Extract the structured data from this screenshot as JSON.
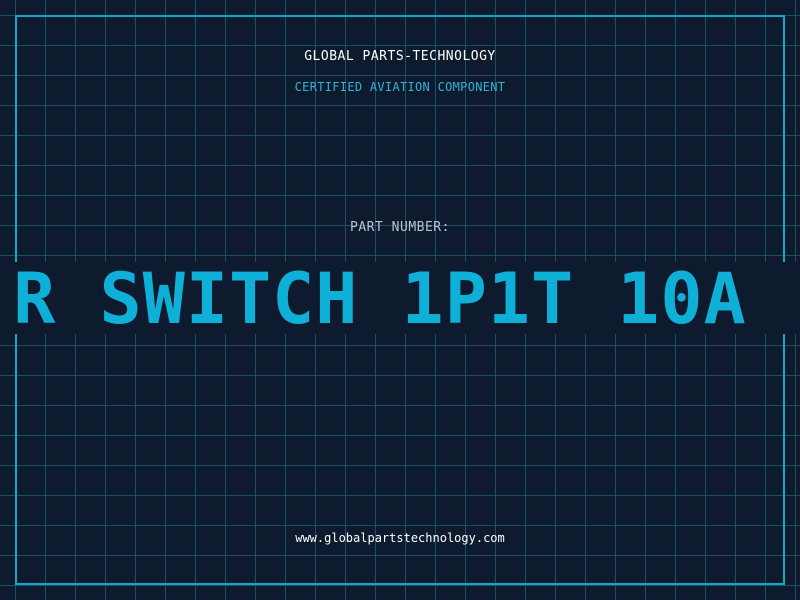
{
  "header": {
    "company": "GLOBAL PARTS-TECHNOLOGY",
    "tagline": "CERTIFIED AVIATION COMPONENT"
  },
  "part": {
    "label": "PART NUMBER:",
    "number": "R SWITCH 1P1T 10A"
  },
  "footer": {
    "website": "www.globalpartstechnology.com"
  },
  "colors": {
    "background": "#0e1a2e",
    "grid": "#1f5870",
    "frame": "#12a6c9",
    "accent": "#0fb0d8",
    "text": "#ffffff"
  }
}
